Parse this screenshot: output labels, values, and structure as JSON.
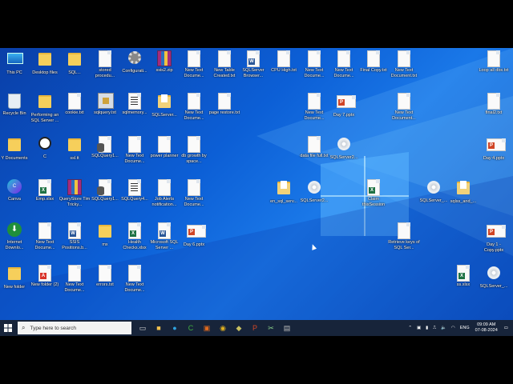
{
  "desktop": {
    "icons": [
      {
        "label": "This PC",
        "type": "pc",
        "col": 0,
        "row": 0
      },
      {
        "label": "Desktop files",
        "type": "folder",
        "col": 1,
        "row": 0
      },
      {
        "label": "SQL...",
        "type": "folder",
        "col": 2,
        "row": 0
      },
      {
        "label": "stored procedu...",
        "type": "doc",
        "col": 3,
        "row": 0
      },
      {
        "label": "Configurati...",
        "type": "gear",
        "col": 4,
        "row": 0
      },
      {
        "label": "ssis2.zip",
        "type": "rar",
        "col": 5,
        "row": 0
      },
      {
        "label": "New Text Docume...",
        "type": "doc",
        "col": 6,
        "row": 0
      },
      {
        "label": "New Table Created.txt",
        "type": "doc",
        "col": 7,
        "row": 0
      },
      {
        "label": "SQLServer Browser...",
        "type": "word",
        "col": 8,
        "row": 0
      },
      {
        "label": "CPU High.txt",
        "type": "doc",
        "col": 9,
        "row": 0
      },
      {
        "label": "New Text Docume...",
        "type": "doc",
        "col": 10,
        "row": 0
      },
      {
        "label": "New Text Docume...",
        "type": "doc",
        "col": 11,
        "row": 0
      },
      {
        "label": "Final Copy.txt",
        "type": "doc",
        "col": 12,
        "row": 0
      },
      {
        "label": "New Text Document.txt",
        "type": "doc",
        "col": 13,
        "row": 0
      },
      {
        "label": "Loop all dbs.txt",
        "type": "doc",
        "col": 16,
        "row": 0
      },
      {
        "label": "Recycle Bin",
        "type": "recycle",
        "col": 0,
        "row": 1
      },
      {
        "label": "Performing an SQL Server ...",
        "type": "folder",
        "col": 1,
        "row": 1
      },
      {
        "label": "cookie.txt",
        "type": "doc",
        "col": 2,
        "row": 1
      },
      {
        "label": "sqlquery.txt",
        "type": "sqlfile",
        "col": 3,
        "row": 1
      },
      {
        "label": "sqlmemory...",
        "type": "sqldoc",
        "col": 4,
        "row": 1
      },
      {
        "label": "SQLServer...",
        "type": "folderdoc",
        "col": 5,
        "row": 1
      },
      {
        "label": "New Text Docume...",
        "type": "doc",
        "col": 6,
        "row": 1
      },
      {
        "label": "page restore.txt",
        "type": "doc",
        "col": 7,
        "row": 1
      },
      {
        "label": "New Text Docume...",
        "type": "doc",
        "col": 10,
        "row": 1
      },
      {
        "label": "Day 7.pptx",
        "type": "ppt",
        "col": 11,
        "row": 1
      },
      {
        "label": "New Text Document...",
        "type": "doc",
        "col": 13,
        "row": 1
      },
      {
        "label": "final2.txt",
        "type": "doc",
        "col": 16,
        "row": 1
      },
      {
        "label": "Y Documents",
        "type": "folder",
        "col": 0,
        "row": 2
      },
      {
        "label": "C",
        "type": "chatgpt",
        "col": 1,
        "row": 2
      },
      {
        "label": "ssl.tt",
        "type": "folder",
        "col": 2,
        "row": 2
      },
      {
        "label": "SQLQuery1...",
        "type": "sqldb",
        "col": 3,
        "row": 2
      },
      {
        "label": "New Text Docume...",
        "type": "doc",
        "col": 4,
        "row": 2
      },
      {
        "label": "power planner",
        "type": "doc",
        "col": 5,
        "row": 2
      },
      {
        "label": "db growth by space...",
        "type": "doc",
        "col": 6,
        "row": 2
      },
      {
        "label": "data file full.txt",
        "type": "doc",
        "col": 10,
        "row": 2
      },
      {
        "label": "SQLServer2...",
        "type": "disc",
        "col": 11,
        "row": 2
      },
      {
        "label": "Day 4.pptx",
        "type": "ppt",
        "col": 16,
        "row": 2
      },
      {
        "label": "Canva",
        "type": "canva",
        "col": 0,
        "row": 3
      },
      {
        "label": "Emp.xlsx",
        "type": "excel",
        "col": 1,
        "row": 3
      },
      {
        "label": "QueryStore Tim Tricky...",
        "type": "rar",
        "col": 2,
        "row": 3
      },
      {
        "label": "SQLQuery1...",
        "type": "sqldb",
        "col": 3,
        "row": 3
      },
      {
        "label": "SQLQuery4...",
        "type": "sqldoc",
        "col": 4,
        "row": 3
      },
      {
        "label": "Job Alerts notification...",
        "type": "doc",
        "col": 5,
        "row": 3
      },
      {
        "label": "New Text Docume...",
        "type": "doc",
        "col": 6,
        "row": 3
      },
      {
        "label": "en_sql_serv...",
        "type": "folderdoc",
        "col": 9,
        "row": 3
      },
      {
        "label": "SQLServer2...",
        "type": "disc",
        "col": 10,
        "row": 3
      },
      {
        "label": "Claim thisSession",
        "type": "excel",
        "col": 12,
        "row": 3
      },
      {
        "label": "SQLServer_...",
        "type": "disc",
        "col": 14,
        "row": 3
      },
      {
        "label": "sqlss_and_...",
        "type": "folderdoc",
        "col": 15,
        "row": 3
      },
      {
        "label": "Internet Downlo...",
        "type": "idm",
        "col": 0,
        "row": 4
      },
      {
        "label": "New Text Docume...",
        "type": "doc",
        "col": 1,
        "row": 4
      },
      {
        "label": "SSIS Positions.b...",
        "type": "word",
        "col": 2,
        "row": 4
      },
      {
        "label": "mx",
        "type": "folder",
        "col": 3,
        "row": 4
      },
      {
        "label": "Health Checks.xlsx",
        "type": "excel",
        "col": 4,
        "row": 4
      },
      {
        "label": "Microsoft SQL Server ...",
        "type": "word",
        "col": 5,
        "row": 4
      },
      {
        "label": "Day 6.pptx",
        "type": "ppt",
        "col": 6,
        "row": 4
      },
      {
        "label": "Retrieve keys of SQL Ser...",
        "type": "doc",
        "col": 13,
        "row": 4
      },
      {
        "label": "Day 1 - Copy.pptx",
        "type": "ppt",
        "col": 16,
        "row": 4
      },
      {
        "label": "New folder",
        "type": "folder",
        "col": 0,
        "row": 5
      },
      {
        "label": "New folder (2)",
        "type": "pdf",
        "col": 1,
        "row": 5
      },
      {
        "label": "New Text Docume...",
        "type": "doc",
        "col": 2,
        "row": 5
      },
      {
        "label": "errors.txt",
        "type": "doc",
        "col": 3,
        "row": 5
      },
      {
        "label": "New Text Docume...",
        "type": "doc",
        "col": 4,
        "row": 5
      },
      {
        "label": "ss.xlsx",
        "type": "excel",
        "col": 15,
        "row": 5
      },
      {
        "label": "SQLServer_...",
        "type": "disc",
        "col": 16,
        "row": 5
      }
    ]
  },
  "taskbar": {
    "search_placeholder": "Type here to search",
    "language": "ENG",
    "time": "09:09 AM",
    "date": "07-08-2024",
    "pinned": [
      {
        "name": "task-view-icon",
        "glyph": "▭",
        "color": "#ddd"
      },
      {
        "name": "file-explorer-icon",
        "glyph": "■",
        "color": "#f2c14e"
      },
      {
        "name": "edge-icon",
        "glyph": "●",
        "color": "#2fa3e0"
      },
      {
        "name": "camtasia-icon",
        "glyph": "C",
        "color": "#3fae3f"
      },
      {
        "name": "office-icon",
        "glyph": "▣",
        "color": "#e06a1e"
      },
      {
        "name": "chrome-icon",
        "glyph": "◉",
        "color": "#e0b020"
      },
      {
        "name": "ssms-icon",
        "glyph": "◆",
        "color": "#c8c060"
      },
      {
        "name": "powerpoint-icon",
        "glyph": "P",
        "color": "#d24726"
      },
      {
        "name": "snip-icon",
        "glyph": "✂",
        "color": "#8ad08a"
      },
      {
        "name": "app-icon",
        "glyph": "▤",
        "color": "#bbb"
      }
    ]
  }
}
